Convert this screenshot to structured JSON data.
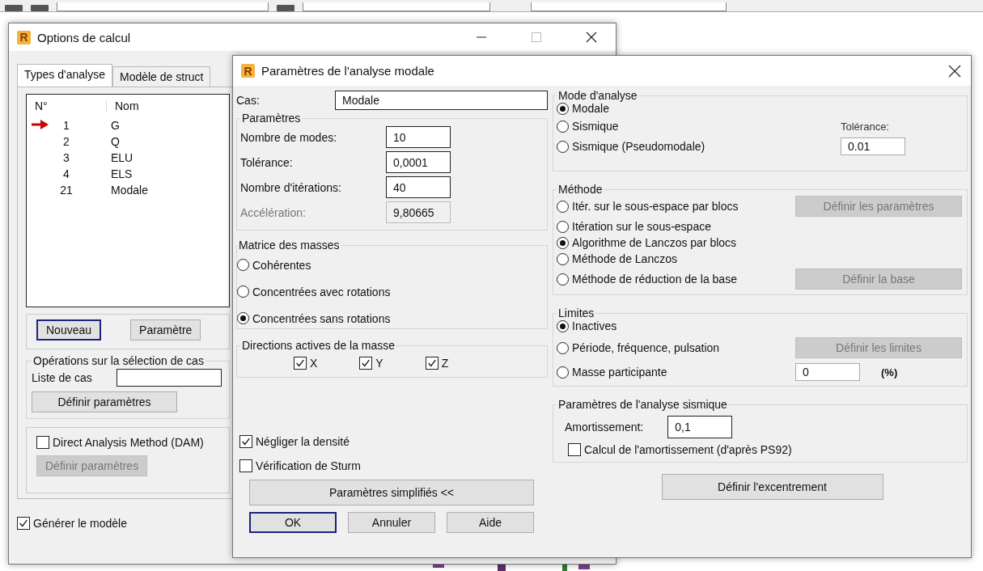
{
  "back_window": {
    "icon_letter": "R",
    "title": "Options de calcul",
    "tabs": [
      {
        "label": "Types d'analyse",
        "selected": true
      },
      {
        "label": "Modèle de struct",
        "selected": false
      }
    ],
    "list": {
      "columns": [
        "N°",
        "Nom"
      ],
      "rows": [
        {
          "number": "1",
          "name": "G",
          "current": true
        },
        {
          "number": "2",
          "name": "Q",
          "current": false
        },
        {
          "number": "3",
          "name": "ELU",
          "current": false
        },
        {
          "number": "4",
          "name": "ELS",
          "current": false
        },
        {
          "number": "21",
          "name": "Modale",
          "current": false
        }
      ]
    },
    "buttons": [
      {
        "label": "Nouveau",
        "default": true
      },
      {
        "label": "Paramètre",
        "default": false
      }
    ],
    "operations": {
      "legend": "Opérations sur la sélection de cas",
      "list_label": "Liste de cas",
      "button": "Définir paramètres"
    },
    "dam": {
      "label": "Direct Analysis Method (DAM)",
      "checked": false,
      "button": {
        "label": "Définir paramètres",
        "disabled": true
      }
    },
    "generate": {
      "label": "Générer le modèle",
      "checked": true
    }
  },
  "dialog": {
    "icon_letter": "R",
    "title": "Paramètres de l'analyse modale",
    "case": {
      "label": "Cas:",
      "value": "Modale"
    },
    "parameters": {
      "legend": "Paramètres",
      "fields": [
        {
          "label": "Nombre de modes:",
          "value": "10",
          "disabled": false
        },
        {
          "label": "Tolérance:",
          "value": "0,0001",
          "disabled": false
        },
        {
          "label": "Nombre d'itérations:",
          "value": "40",
          "disabled": false
        },
        {
          "label": "Accélération:",
          "value": "9,80665",
          "disabled": true
        }
      ]
    },
    "mass_matrix": {
      "legend": "Matrice des masses",
      "options": [
        {
          "label": "Cohérentes",
          "selected": false
        },
        {
          "label": "Concentrées avec rotations",
          "selected": false
        },
        {
          "label": "Concentrées sans rotations",
          "selected": true
        }
      ]
    },
    "directions": {
      "legend": "Directions actives de la masse",
      "items": [
        {
          "label": "X",
          "checked": true
        },
        {
          "label": "Y",
          "checked": true
        },
        {
          "label": "Z",
          "checked": true
        }
      ]
    },
    "options": [
      {
        "label": "Négliger la densité",
        "checked": true
      },
      {
        "label": "Vérification de Sturm",
        "checked": false
      }
    ],
    "toggle_button": "Paramètres simplifiés <<",
    "buttons": [
      {
        "label": "OK",
        "default": true
      },
      {
        "label": "Annuler",
        "default": false
      },
      {
        "label": "Aide",
        "default": false
      }
    ],
    "analysis_mode": {
      "legend": "Mode d'analyse",
      "options": [
        {
          "label": "Modale",
          "selected": true
        },
        {
          "label": "Sismique",
          "selected": false
        },
        {
          "label": "Sismique (Pseudomodale)",
          "selected": false
        }
      ],
      "tolerance_label": "Tolérance:",
      "tolerance_value": "0.01"
    },
    "method": {
      "legend": "Méthode",
      "options": [
        {
          "label": "Itér. sur le sous-espace par blocs",
          "selected": false,
          "button": {
            "label": "Définir les paramètres",
            "disabled": true
          }
        },
        {
          "label": "Itération sur le sous-espace",
          "selected": false
        },
        {
          "label": "Algorithme de Lanczos par blocs",
          "selected": true
        },
        {
          "label": "Méthode de Lanczos",
          "selected": false
        },
        {
          "label": "Méthode de réduction de la base",
          "selected": false,
          "button": {
            "label": "Définir la base",
            "disabled": true
          }
        }
      ]
    },
    "limits": {
      "legend": "Limites",
      "options": [
        {
          "label": "Inactives",
          "selected": true
        },
        {
          "label": "Période, fréquence, pulsation",
          "selected": false
        },
        {
          "label": "Masse participante",
          "selected": false
        }
      ],
      "button": {
        "label": "Définir les limites",
        "disabled": true
      },
      "value": "0",
      "unit": "(%)"
    },
    "seismic": {
      "legend": "Paramètres de l'analyse sismique",
      "damping_label": "Amortissement:",
      "damping_value": "0,1",
      "checkbox": {
        "label": "Calcul de l'amortissement (d'après PS92)",
        "checked": false
      }
    },
    "eccentricity_button": "Définir l'excentrement"
  }
}
